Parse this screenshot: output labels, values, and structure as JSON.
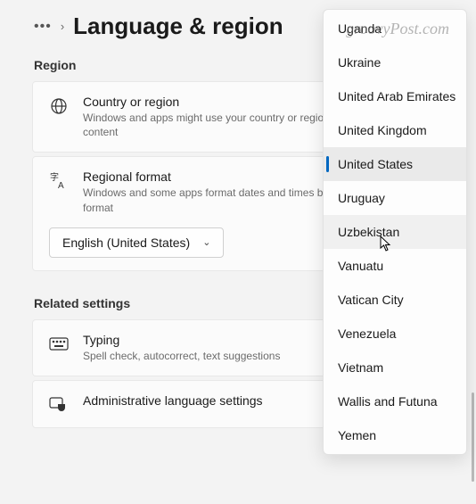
{
  "header": {
    "title": "Language & region"
  },
  "watermark": "groovyPost.com",
  "sections": {
    "region_label": "Region",
    "related_label": "Related settings"
  },
  "cards": {
    "country": {
      "title": "Country or region",
      "desc": "Windows and apps might use your country or region to give you local content"
    },
    "format": {
      "title": "Regional format",
      "desc": "Windows and some apps format dates and times based on your regional format",
      "selected": "English (United States)"
    },
    "typing": {
      "title": "Typing",
      "desc": "Spell check, autocorrect, text suggestions"
    },
    "admin": {
      "title": "Administrative language settings"
    }
  },
  "dropdown": {
    "items": [
      "Uganda",
      "Ukraine",
      "United Arab Emirates",
      "United Kingdom",
      "United States",
      "Uruguay",
      "Uzbekistan",
      "Vanuatu",
      "Vatican City",
      "Venezuela",
      "Vietnam",
      "Wallis and Futuna",
      "Yemen"
    ],
    "selected_index": 4,
    "hovered_index": 6
  }
}
